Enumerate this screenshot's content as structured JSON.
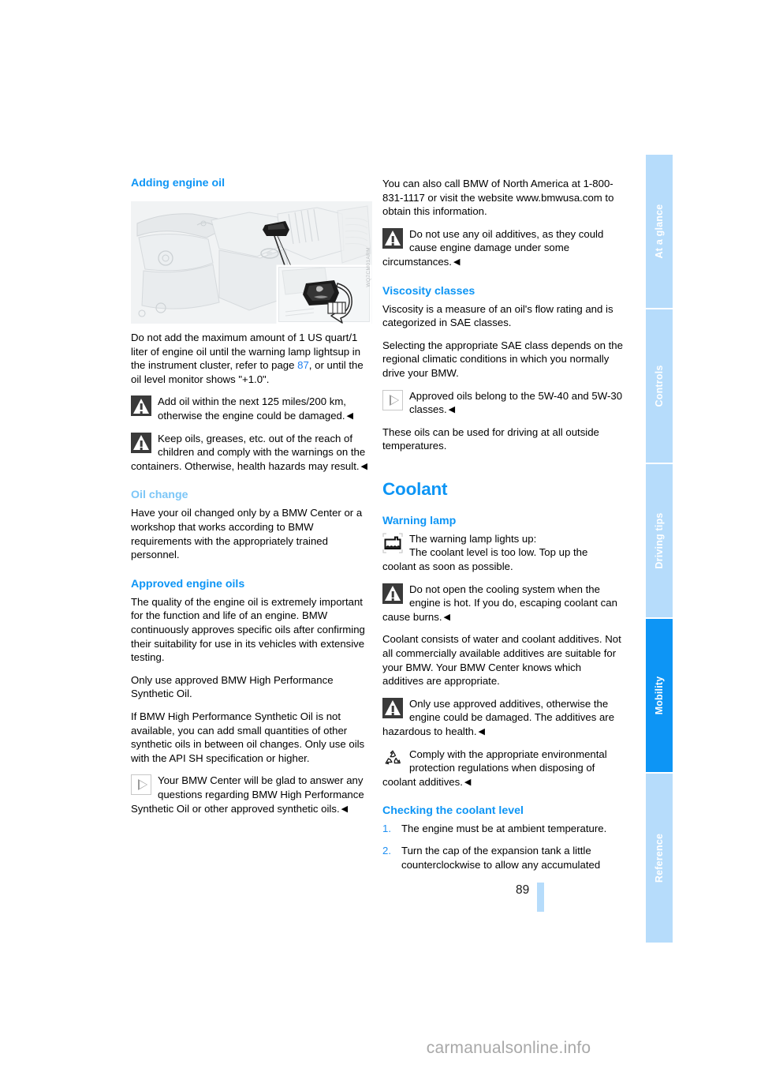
{
  "page": {
    "number": "89",
    "watermark": "carmanualsonline.info"
  },
  "sidebar": {
    "tabs": [
      {
        "label": "At a glance",
        "active": false
      },
      {
        "label": "Controls",
        "active": false
      },
      {
        "label": "Driving tips",
        "active": false
      },
      {
        "label": "Mobility",
        "active": true
      },
      {
        "label": "Reference",
        "active": false
      }
    ]
  },
  "colors": {
    "heading_blue": "#0d95f5",
    "heading_blue_soft": "#7cc6f7",
    "tab_blue": "#b6dcfb",
    "tab_blue_active": "#0d95f5",
    "link_blue": "#1f7ff0"
  },
  "figure": {
    "alt": "Engine bay with oil filler cap callout and counterclockwise turn arrow",
    "id_text": "WQ7CM01ARM"
  },
  "left_column": {
    "heading_adding_engine_oil": "Adding engine oil",
    "p_do_not_add_1": "Do not add the maximum amount of 1 US quart/",
    "p_do_not_add_2": "1 liter of engine oil until the warning lamp lights",
    "p_do_not_add_3": "up in the instrument cluster, refer to page ",
    "p_do_not_add_pageref": "87",
    "p_do_not_add_4": ", or",
    "p_do_not_add_5": "until the oil level monitor shows \"+1.0\".",
    "note_add_oil_125": "Add oil within the next 125 miles/200 km, otherwise the engine could be damaged.",
    "note_keep_oils": "Keep oils, greases, etc. out of the reach of children and comply with the warnings on the containers. Otherwise, health hazards may result.",
    "heading_oil_change": "Oil change",
    "p_oil_change": "Have your oil changed only by a BMW Center or a workshop that works according to BMW requirements with the appropriately trained personnel.",
    "heading_approved_engine_oils": "Approved engine oils",
    "p_quality": "The quality of the engine oil is extremely important for the function and life of an engine. BMW continuously approves specific oils after confirming their suitability for use in its vehicles with extensive testing.",
    "p_only_use_approved": "Only use approved BMW High Performance Synthetic Oil.",
    "p_if_not_available": "If BMW High Performance Synthetic Oil is not available, you can add small quantities of other synthetic oils in between oil changes. Only use oils with the API SH specification or higher.",
    "note_bmw_center_answer": "Your BMW Center will be glad to answer any questions regarding BMW High Performance Synthetic Oil or other approved synthetic oils."
  },
  "right_column": {
    "p_call_bmw": "You can also call BMW of North America at 1-800-831-1117 or visit the website www.bmwusa.com to obtain this information.",
    "note_no_additives": "Do not use any oil additives, as they could cause engine damage under some circumstances.",
    "heading_viscosity_classes": "Viscosity classes",
    "p_viscosity_measure": "Viscosity is a measure of an oil's flow rating and is categorized in SAE classes.",
    "p_selecting_sae": "Selecting the appropriate SAE class depends on the regional climatic conditions in which you normally drive your BMW.",
    "note_approved_oils_5w": "Approved oils belong to the 5W-40 and 5W-30 classes.",
    "p_all_outside_temps": "These oils can be used for driving at all outside temperatures.",
    "heading_coolant": "Coolant",
    "heading_warning_lamp": "Warning lamp",
    "note_warning_lamp_line1": "The warning lamp lights up:",
    "note_warning_lamp_line2": "The coolant level is too low. Top up the coolant as soon as possible.",
    "note_do_not_open": "Do not open the cooling system when the engine is hot. If you do, escaping coolant can cause burns.",
    "p_coolant_consists": "Coolant consists of water and coolant additives. Not all commercially available additives are suitable for your BMW. Your BMW Center knows which additives are appropriate.",
    "note_only_approved_additives": "Only use approved additives, otherwise the engine could be damaged. The additives are hazardous to health.",
    "note_comply_environmental": "Comply with the appropriate environmental protection regulations when disposing of coolant additives.",
    "heading_checking_coolant": "Checking the coolant level",
    "steps": [
      {
        "num": "1.",
        "text": "The engine must be at ambient temperature."
      },
      {
        "num": "2.",
        "text": "Turn the cap of the expansion tank a little counterclockwise to allow any accumulated"
      }
    ]
  },
  "icons": {
    "warning": "warning-triangle-icon",
    "info": "info-triangle-icon",
    "coolant_lamp": "coolant-warning-lamp-icon",
    "recycle": "recycling-icon",
    "end_marker": "◀"
  }
}
